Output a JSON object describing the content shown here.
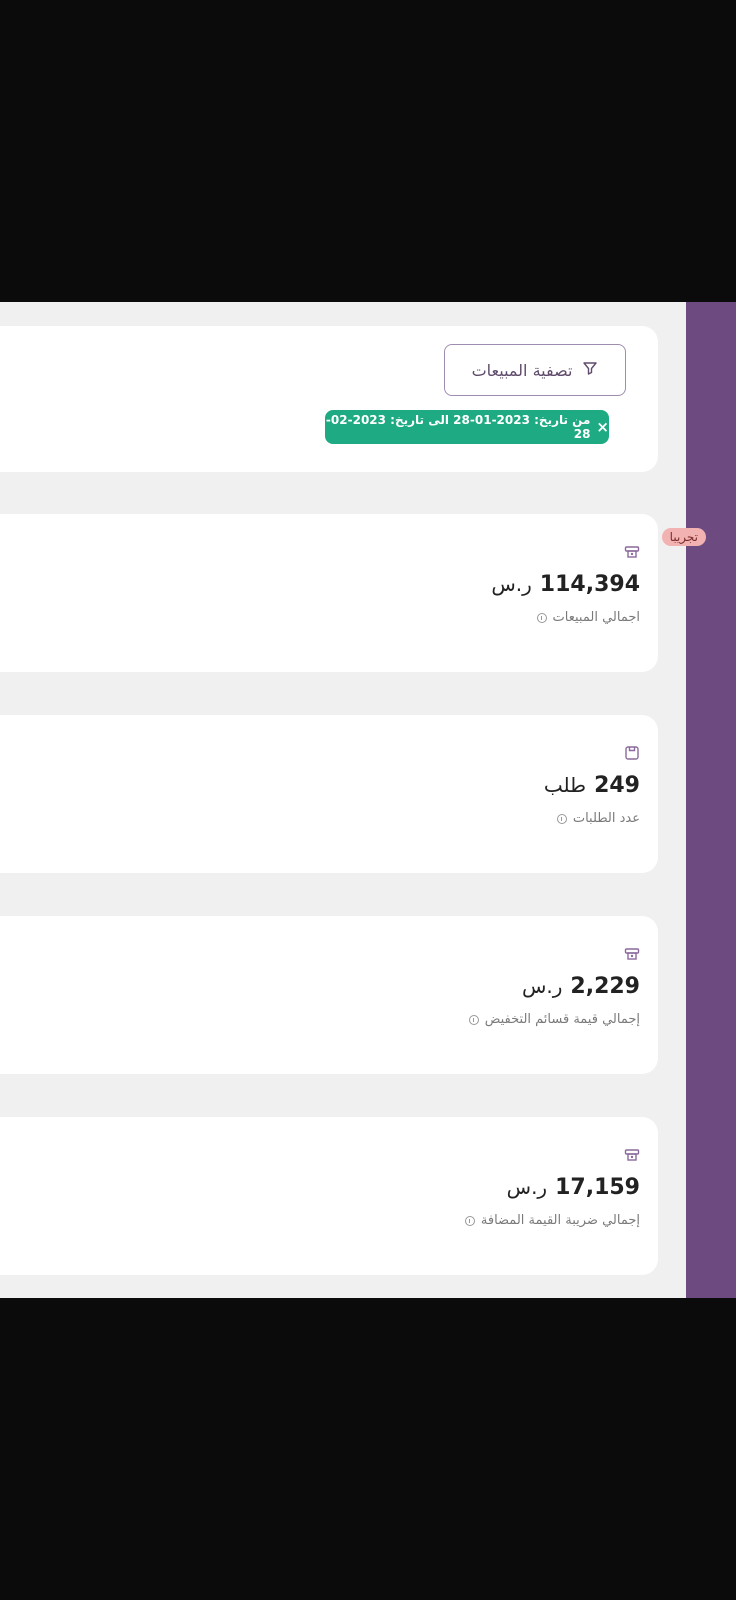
{
  "filter": {
    "button_label": "تصفية المبيعات",
    "icon": "filter-icon",
    "date_chip": {
      "close": "×",
      "text": "من تاريخ: 2023-01-28 الى تاريخ: 2023-02-28"
    }
  },
  "sidebar": {
    "badge": "تجريبا",
    "color": "#6d4b80"
  },
  "stats": {
    "sales": {
      "value": "114,394",
      "unit": "ر.س",
      "label": "اجمالي المبيعات",
      "icon": "cash-icon"
    },
    "orders": {
      "value": "249",
      "unit": "طلب",
      "label": "عدد الطلبات",
      "icon": "box-icon"
    },
    "discount": {
      "value": "2,229",
      "unit": "ر.س",
      "label": "إجمالي قيمة قسائم التخفيض",
      "icon": "cash-icon"
    },
    "vat": {
      "value": "17,159",
      "unit": "ر.س",
      "label": "إجمالي ضريبة القيمة المضافة",
      "icon": "cash-icon"
    }
  },
  "colors": {
    "accent": "#1eaa82",
    "primary": "#6d4b80"
  }
}
